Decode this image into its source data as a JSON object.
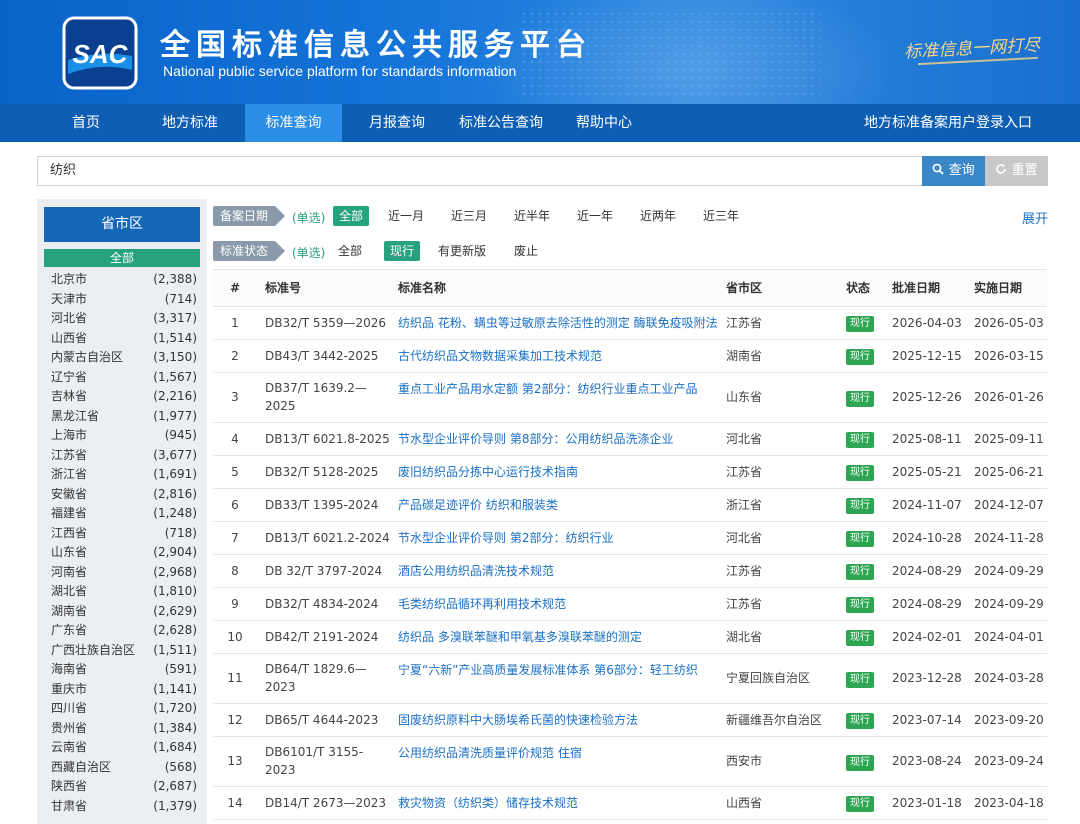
{
  "header": {
    "logo_text": "SAC",
    "title": "全国标准信息公共服务平台",
    "subtitle": "National public service platform  for standards information",
    "slogan": "标准信息一网打尽"
  },
  "nav": {
    "items": [
      {
        "label": "首页"
      },
      {
        "label": "地方标准"
      },
      {
        "label": "标准查询"
      },
      {
        "label": "月报查询"
      },
      {
        "label": "标准公告查询"
      },
      {
        "label": "帮助中心"
      }
    ],
    "login": "地方标准备案用户登录入口"
  },
  "search": {
    "value": "纺织",
    "search_label": "查询",
    "reset_label": "重置"
  },
  "sidebar": {
    "title": "省市区",
    "all_label": "全部",
    "provinces": [
      {
        "name": "北京市",
        "count": "(2,388)"
      },
      {
        "name": "天津市",
        "count": "(714)"
      },
      {
        "name": "河北省",
        "count": "(3,317)"
      },
      {
        "name": "山西省",
        "count": "(1,514)"
      },
      {
        "name": "内蒙古自治区",
        "count": "(3,150)"
      },
      {
        "name": "辽宁省",
        "count": "(1,567)"
      },
      {
        "name": "吉林省",
        "count": "(2,216)"
      },
      {
        "name": "黑龙江省",
        "count": "(1,977)"
      },
      {
        "name": "上海市",
        "count": "(945)"
      },
      {
        "name": "江苏省",
        "count": "(3,677)"
      },
      {
        "name": "浙江省",
        "count": "(1,691)"
      },
      {
        "name": "安徽省",
        "count": "(2,816)"
      },
      {
        "name": "福建省",
        "count": "(1,248)"
      },
      {
        "name": "江西省",
        "count": "(718)"
      },
      {
        "name": "山东省",
        "count": "(2,904)"
      },
      {
        "name": "河南省",
        "count": "(2,968)"
      },
      {
        "name": "湖北省",
        "count": "(1,810)"
      },
      {
        "name": "湖南省",
        "count": "(2,629)"
      },
      {
        "name": "广东省",
        "count": "(2,628)"
      },
      {
        "name": "广西壮族自治区",
        "count": "(1,511)"
      },
      {
        "name": "海南省",
        "count": "(591)"
      },
      {
        "name": "重庆市",
        "count": "(1,141)"
      },
      {
        "name": "四川省",
        "count": "(1,720)"
      },
      {
        "name": "贵州省",
        "count": "(1,384)"
      },
      {
        "name": "云南省",
        "count": "(1,684)"
      },
      {
        "name": "西藏自治区",
        "count": "(568)"
      },
      {
        "name": "陕西省",
        "count": "(2,687)"
      },
      {
        "name": "甘肃省",
        "count": "(1,379)"
      }
    ]
  },
  "filters": {
    "date": {
      "label": "备案日期",
      "hint": "(单选)",
      "options": [
        "全部",
        "近一月",
        "近三月",
        "近半年",
        "近一年",
        "近两年",
        "近三年"
      ]
    },
    "status": {
      "label": "标准状态",
      "hint": "(单选)",
      "options": [
        "全部",
        "现行",
        "有更新版",
        "废止"
      ]
    },
    "expand": "展开"
  },
  "table": {
    "headers": [
      "#",
      "标准号",
      "标准名称",
      "省市区",
      "状态",
      "批准日期",
      "实施日期"
    ],
    "rows": [
      {
        "no": "1",
        "code": "DB32/T 5359—2026",
        "title": "纺织品 花粉、螨虫等过敏原去除活性的测定 酶联免疫吸附法",
        "region": "江苏省",
        "status": "现行",
        "approve": "2026-04-03",
        "implement": "2026-05-03"
      },
      {
        "no": "2",
        "code": "DB43/T 3442-2025",
        "title": "古代纺织品文物数据采集加工技术规范",
        "region": "湖南省",
        "status": "现行",
        "approve": "2025-12-15",
        "implement": "2026-03-15"
      },
      {
        "no": "3",
        "code": "DB37/T 1639.2—2025",
        "title": "重点工业产品用水定额 第2部分：纺织行业重点工业产品",
        "region": "山东省",
        "status": "现行",
        "approve": "2025-12-26",
        "implement": "2026-01-26"
      },
      {
        "no": "4",
        "code": "DB13/T 6021.8-2025",
        "title": "节水型企业评价导则 第8部分：公用纺织品洗涤企业",
        "region": "河北省",
        "status": "现行",
        "approve": "2025-08-11",
        "implement": "2025-09-11"
      },
      {
        "no": "5",
        "code": "DB32/T 5128-2025",
        "title": "废旧纺织品分拣中心运行技术指南",
        "region": "江苏省",
        "status": "现行",
        "approve": "2025-05-21",
        "implement": "2025-06-21"
      },
      {
        "no": "6",
        "code": "DB33/T 1395-2024",
        "title": "产品碳足迹评价 纺织和服装类",
        "region": "浙江省",
        "status": "现行",
        "approve": "2024-11-07",
        "implement": "2024-12-07"
      },
      {
        "no": "7",
        "code": "DB13/T 6021.2-2024",
        "title": "节水型企业评价导则 第2部分：纺织行业",
        "region": "河北省",
        "status": "现行",
        "approve": "2024-10-28",
        "implement": "2024-11-28"
      },
      {
        "no": "8",
        "code": "DB 32/T 3797-2024",
        "title": "酒店公用纺织品清洗技术规范",
        "region": "江苏省",
        "status": "现行",
        "approve": "2024-08-29",
        "implement": "2024-09-29"
      },
      {
        "no": "9",
        "code": "DB32/T 4834-2024",
        "title": "毛类纺织品循环再利用技术规范",
        "region": "江苏省",
        "status": "现行",
        "approve": "2024-08-29",
        "implement": "2024-09-29"
      },
      {
        "no": "10",
        "code": "DB42/T 2191-2024",
        "title": "纺织品 多溴联苯醚和甲氧基多溴联苯醚的测定",
        "region": "湖北省",
        "status": "现行",
        "approve": "2024-02-01",
        "implement": "2024-04-01"
      },
      {
        "no": "11",
        "code": "DB64/T 1829.6—2023",
        "title": "宁夏“六新”产业高质量发展标准体系 第6部分：轻工纺织",
        "region": "宁夏回族自治区",
        "status": "现行",
        "approve": "2023-12-28",
        "implement": "2024-03-28"
      },
      {
        "no": "12",
        "code": "DB65/T 4644-2023",
        "title": "固废纺织原料中大肠埃希氏菌的快速检验方法",
        "region": "新疆维吾尔自治区",
        "status": "现行",
        "approve": "2023-07-14",
        "implement": "2023-09-20"
      },
      {
        "no": "13",
        "code": "DB6101/T 3155-2023",
        "title": "公用纺织品清洗质量评价规范 住宿",
        "region": "西安市",
        "status": "现行",
        "approve": "2023-08-24",
        "implement": "2023-09-24"
      },
      {
        "no": "14",
        "code": "DB14/T 2673—2023",
        "title": "救灾物资（纺织类）储存技术规范",
        "region": "山西省",
        "status": "现行",
        "approve": "2023-01-18",
        "implement": "2023-04-18"
      }
    ]
  }
}
